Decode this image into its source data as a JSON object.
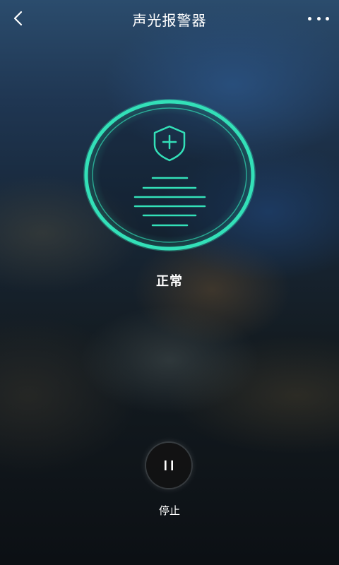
{
  "header": {
    "title": "声光报警器",
    "back_icon": "chevron-left-icon",
    "more_icon": "more-dots-icon"
  },
  "status": {
    "text": "正常",
    "ring_color": "#33e0b8",
    "icons": [
      "shield-plus-icon",
      "sound-lines-icon"
    ]
  },
  "control": {
    "button_icon": "pause-icon",
    "label": "停止"
  },
  "colors": {
    "accent": "#33e0b8",
    "text": "#ffffff"
  }
}
